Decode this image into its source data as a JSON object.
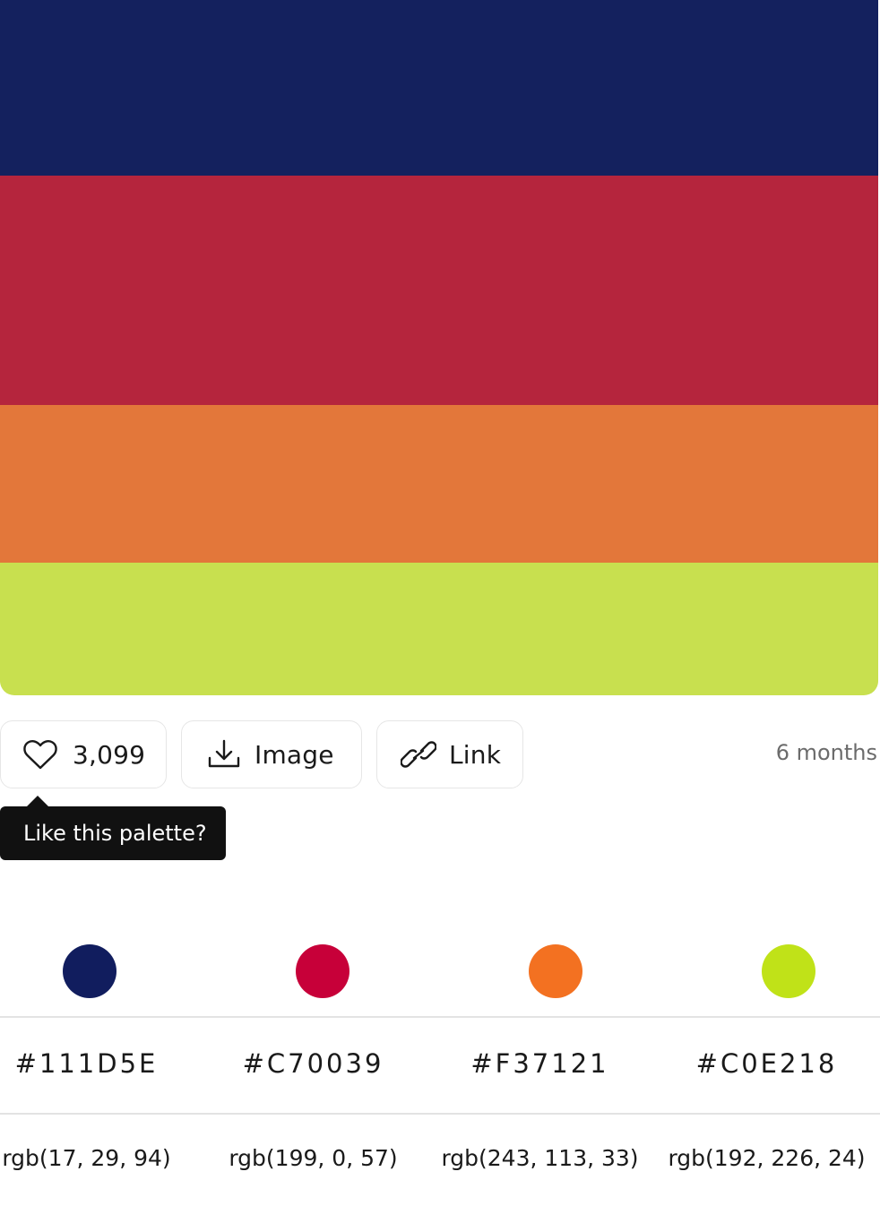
{
  "palette": {
    "colors": [
      "#14215E",
      "#B5253D",
      "#E3773A",
      "#C8E04F"
    ]
  },
  "actions": {
    "like_count": "3,099",
    "image_label": "Image",
    "link_label": "Link",
    "age": "6 months"
  },
  "tooltip": {
    "text": "Like this palette?"
  },
  "details": {
    "dot_colors": [
      "#111D5E",
      "#C70039",
      "#F37121",
      "#C0E218"
    ],
    "hex": [
      "#111D5E",
      "#C70039",
      "#F37121",
      "#C0E218"
    ],
    "rgb": [
      "rgb(17, 29, 94)",
      "rgb(199, 0, 57)",
      "rgb(243, 113, 33)",
      "rgb(192, 226, 24)"
    ]
  }
}
